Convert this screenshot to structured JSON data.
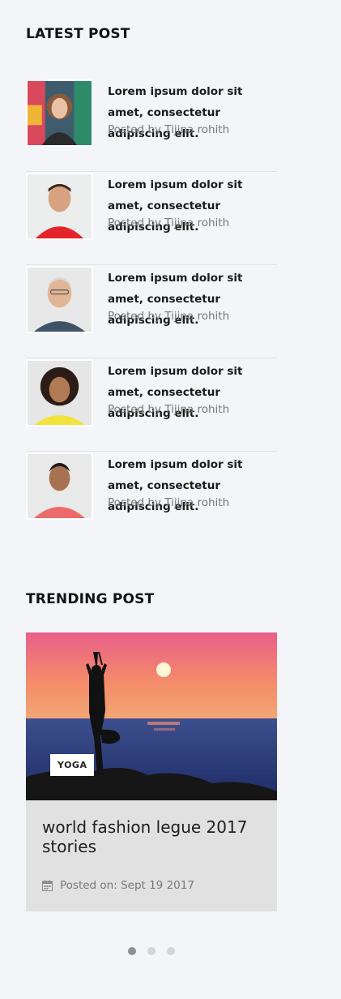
{
  "latest": {
    "title": "LATEST POST",
    "posts": [
      {
        "title": "Lorem ipsum dolor sit amet, consectetur adipiscing elit.",
        "author": "Posted by Tijina rohith"
      },
      {
        "title": "Lorem ipsum dolor sit amet, consectetur adipiscing elit.",
        "author": "Posted by Tijina rohith"
      },
      {
        "title": "Lorem ipsum dolor sit amet, consectetur adipiscing elit.",
        "author": "Posted by Tijina rohith"
      },
      {
        "title": "Lorem ipsum dolor sit amet, consectetur adipiscing elit.",
        "author": "Posted by Tijina rohith"
      },
      {
        "title": "Lorem ipsum dolor sit amet, consectetur adipiscing elit.",
        "author": "Posted by Tijina rohith"
      }
    ]
  },
  "trending": {
    "title": "TRENDING POST",
    "badge": "YOGA",
    "post_title": "world fashion legue 2017 stories",
    "date": "Posted on: Sept 19 2017",
    "icon": "calendar-icon"
  },
  "carousel": {
    "dots": 3,
    "active": 1
  },
  "colors": {
    "background": "#f3f5f9",
    "card": "#e1e1e1",
    "dot_active": "#8e9094",
    "dot_inactive": "#d3d5d9"
  }
}
